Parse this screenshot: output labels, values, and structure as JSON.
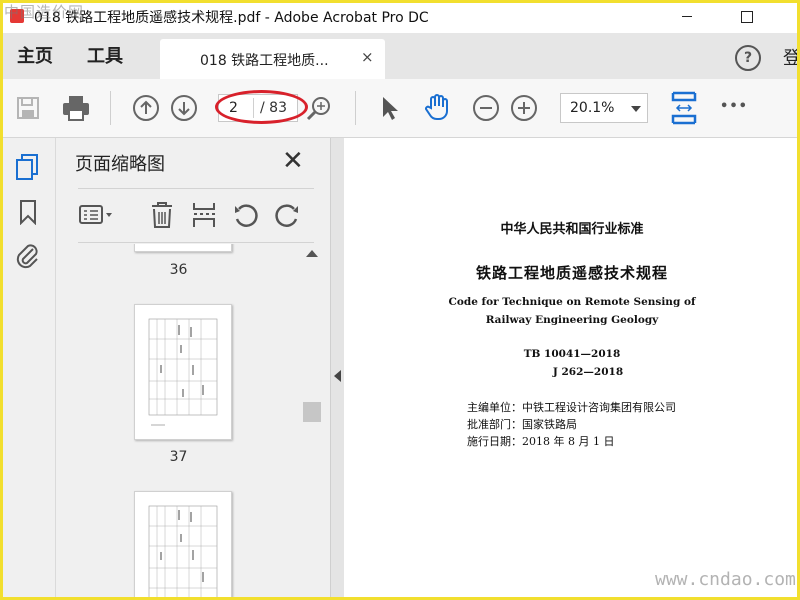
{
  "window": {
    "title": "018 铁路工程地质遥感技术规程.pdf - Adobe Acrobat Pro DC",
    "watermark_top_left": "中国造价网"
  },
  "menu": {
    "home": "主页",
    "tools": "工具",
    "signin": "登"
  },
  "tab": {
    "label": "018 铁路工程地质...",
    "close": "×"
  },
  "help": "?",
  "toolbar": {
    "current_page": "2",
    "total_pages": "/ 83",
    "zoom": "20.1%",
    "more": "•••"
  },
  "panel": {
    "title": "页面缩略图",
    "thumbnails": [
      {
        "label": "36"
      },
      {
        "label": "37"
      },
      {
        "label": ""
      }
    ]
  },
  "document": {
    "line1": "中华人民共和国行业标准",
    "line2": "铁路工程地质遥感技术规程",
    "line3": "Code for Technique on Remote Sensing of",
    "line4": "Railway Engineering Geology",
    "line5": "TB 10041—2018",
    "line6": "J 262—2018",
    "editor": "主编单位：中铁工程设计咨询集团有限公司",
    "approver": "批准部门：国家铁路局",
    "date": "施行日期：2018 年 8 月 1 日"
  },
  "watermark_bottom_right": "www.cndao.com",
  "colors": {
    "accent_blue": "#1a6fd1",
    "highlight_red": "#d8212b",
    "frame_yellow": "#f2df2e"
  }
}
